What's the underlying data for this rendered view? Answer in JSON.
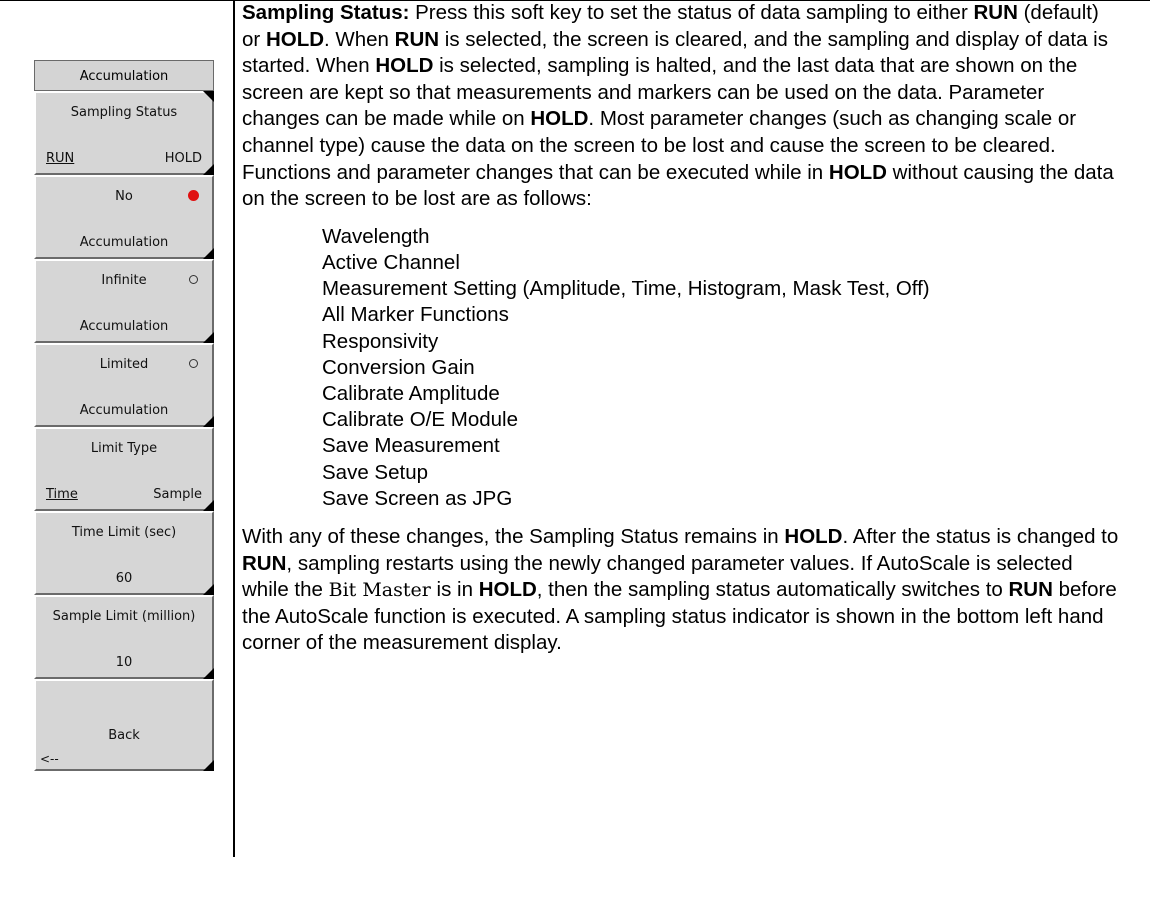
{
  "menu": {
    "title": "Accumulation",
    "keys": [
      {
        "label": "Sampling Status",
        "option_a": "RUN",
        "option_b": "HOLD"
      },
      {
        "label_top": "No",
        "label_bottom": "Accumulation",
        "radio": "on"
      },
      {
        "label_top": "Infinite",
        "label_bottom": "Accumulation",
        "radio": "off"
      },
      {
        "label_top": "Limited",
        "label_bottom": "Accumulation",
        "radio": "off"
      },
      {
        "label": "Limit Type",
        "option_a": "Time",
        "option_b": "Sample"
      },
      {
        "label": "Time Limit (sec)",
        "value": "60"
      },
      {
        "label": "Sample Limit (million)",
        "value": "10"
      },
      {
        "label": "Back",
        "footer": "<--"
      }
    ]
  },
  "doc": {
    "heading": "Sampling Status:",
    "p1": [
      " Press this soft key to set the status of data sampling to either ",
      "RUN",
      " (default) or ",
      "HOLD",
      ". When ",
      "RUN",
      " is selected, the screen is cleared, and the sampling and display of data is started. When ",
      "HOLD",
      " is selected, sampling is halted, and the last data that are shown on the screen are kept so that measurements and markers can be used on the data. Parameter changes can be made while on ",
      "HOLD",
      ". Most parameter changes (such as changing scale or channel type) cause the data on the screen to be lost and cause the screen to be cleared."
    ],
    "p2": [
      "Functions and parameter changes that can be executed while in ",
      "HOLD",
      " without causing the data on the screen to be lost are as follows:"
    ],
    "list": [
      "Wavelength",
      "Active Channel",
      "Measurement Setting (Amplitude, Time, Histogram, Mask Test, Off)",
      "All Marker Functions",
      "Responsivity",
      "Conversion Gain",
      "Calibrate Amplitude",
      "Calibrate O/E Module",
      "Save Measurement",
      "Save Setup",
      "Save Screen as JPG"
    ],
    "p3": [
      "With any of these changes, the Sampling Status remains in ",
      "HOLD",
      ". After the status is changed to ",
      "RUN",
      ", sampling restarts using the newly changed parameter values. If AutoScale is selected while the ",
      "Bit Master",
      " is in ",
      "HOLD",
      ", then the sampling status automatically switches to ",
      "RUN",
      " before the AutoScale function is executed. A sampling status indicator is shown in the bottom left hand corner of the measurement display."
    ]
  }
}
